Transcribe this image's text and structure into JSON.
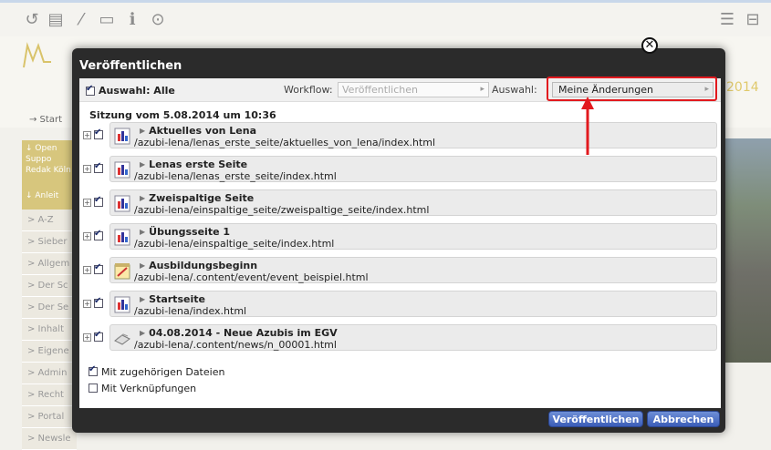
{
  "toolbar": {
    "icons": [
      "history-icon",
      "clipboard-icon",
      "magic-wand-icon",
      "folder-icon",
      "info-icon",
      "target-icon"
    ],
    "right_icons": [
      "list-icon",
      "tree-icon"
    ]
  },
  "background": {
    "year_text": "2014",
    "breadcrumb": "→ Start",
    "yellow_block": "↓ Open Suppo Redak Köln",
    "yellow_block2": "↓ Anleit",
    "side_items": [
      "> A-Z",
      "> Sieber",
      "> Allgem",
      "> Der Sc",
      "> Der Se",
      "> Inhalt",
      "> Eigene",
      "> Admin",
      "> Recht",
      "> Portal",
      "> Newsle"
    ]
  },
  "dialog": {
    "title": "Veröffentlichen",
    "select_all_label": "Auswahl: Alle",
    "workflow_label": "Workflow:",
    "workflow_value": "Veröffentlichen",
    "selection_label": "Auswahl:",
    "selection_value": "Meine Änderungen",
    "session_label": "Sitzung vom 5.08.2014 um 10:36",
    "resources": [
      {
        "title": "Aktuelles von Lena",
        "path": "/azubi-lena/lenas_erste_seite/aktuelles_von_lena/index.html",
        "icon": "page-icon"
      },
      {
        "title": "Lenas erste Seite",
        "path": "/azubi-lena/lenas_erste_seite/index.html",
        "icon": "page-icon"
      },
      {
        "title": "Zweispaltige Seite",
        "path": "/azubi-lena/einspaltige_seite/zweispaltige_seite/index.html",
        "icon": "page-icon"
      },
      {
        "title": "Übungsseite 1",
        "path": "/azubi-lena/einspaltige_seite/index.html",
        "icon": "page-icon"
      },
      {
        "title": "Ausbildungsbeginn",
        "path": "/azubi-lena/.content/event/event_beispiel.html",
        "icon": "event-icon"
      },
      {
        "title": "Startseite",
        "path": "/azubi-lena/index.html",
        "icon": "page-icon"
      },
      {
        "title": "04.08.2014 - Neue Azubis im EGV",
        "path": "/azubi-lena/.content/news/n_00001.html",
        "icon": "news-icon"
      }
    ],
    "option_related": "Mit zugehörigen Dateien",
    "option_links": "Mit Verknüpfungen",
    "publish_button": "Veröffentlichen",
    "cancel_button": "Abbrechen"
  },
  "colors": {
    "highlight": "#e2191e",
    "button": "#3b5db8",
    "dialog_frame": "#2b2b2b"
  }
}
